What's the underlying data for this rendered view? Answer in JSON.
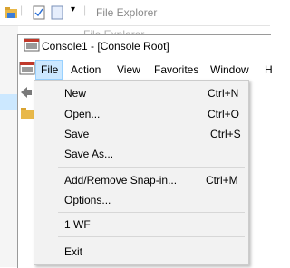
{
  "explorer": {
    "title": "File Explorer",
    "ghost_title": "File Explorer"
  },
  "console": {
    "title": "Console1 - [Console Root]",
    "menubar": [
      "File",
      "Action",
      "View",
      "Favorites",
      "Window",
      "H"
    ]
  },
  "file_menu": {
    "items": [
      {
        "label": "New",
        "shortcut": "Ctrl+N"
      },
      {
        "label": "Open...",
        "shortcut": "Ctrl+O"
      },
      {
        "label": "Save",
        "shortcut": "Ctrl+S"
      },
      {
        "label": "Save As...",
        "shortcut": ""
      },
      {
        "label": "Add/Remove Snap-in...",
        "shortcut": "Ctrl+M"
      },
      {
        "label": "Options...",
        "shortcut": ""
      },
      {
        "label": "1 WF",
        "shortcut": ""
      },
      {
        "label": "Exit",
        "shortcut": ""
      }
    ]
  },
  "colors": {
    "menu_background": "#f2f2f2",
    "highlight": "#cce8ff",
    "highlight_border": "#99d1ff"
  }
}
